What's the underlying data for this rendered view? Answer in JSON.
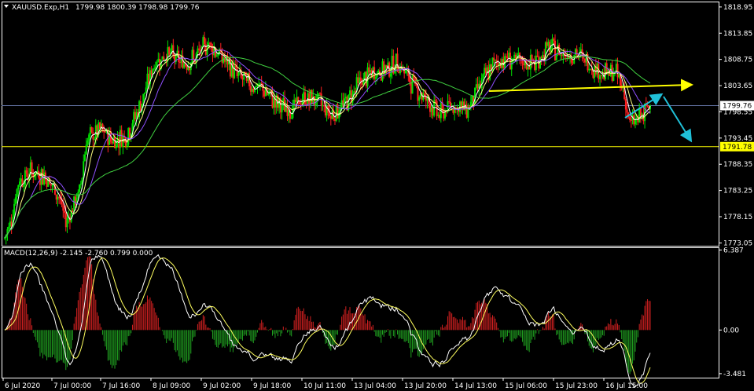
{
  "header": {
    "symbol": "XAUUSD.Exp,H1",
    "ohlc": "1799.98 1800.39 1798.98 1799.76",
    "macd_label": "MACD(12,26,9) -2.145 -2.760 0.799 0.000"
  },
  "colors": {
    "background": "#000000",
    "frame": "#ffffff",
    "bull": "#00e000",
    "bear": "#ff2020",
    "ma_fast": "#ffffff",
    "ma_mid": "#ffff80",
    "ma_slow": "#9050ff",
    "ma_long": "#40d040",
    "level": "#ffff00",
    "bid_line": "#6070a0",
    "arrow_yellow": "#ffff00",
    "arrow_cyan": "#20c0d8",
    "macd_pos": "#d02020",
    "macd_neg": "#20a020",
    "macd_line": "#ffffff",
    "signal_line": "#ffff60"
  },
  "chart_data": [
    {
      "type": "candlestick",
      "title": "XAUUSD.Exp,H1",
      "y_ticks": [
        "1818.95",
        "1813.85",
        "1808.75",
        "1803.65",
        "1798.55",
        "1793.45",
        "1788.35",
        "1783.25",
        "1778.15",
        "1773.05"
      ],
      "ylim": [
        1772.5,
        1820.0
      ],
      "x_ticks": [
        "6 Jul 2020",
        "7 Jul 00:00",
        "7 Jul 16:00",
        "8 Jul 09:00",
        "9 Jul 02:00",
        "9 Jul 18:00",
        "10 Jul 11:00",
        "13 Jul 04:00",
        "13 Jul 20:00",
        "14 Jul 13:00",
        "15 Jul 06:00",
        "15 Jul 23:00",
        "16 Jul 15:00"
      ],
      "current_price": "1799.76",
      "horizontal_level": "1791.78",
      "close_anchors": [
        [
          0,
          1774
        ],
        [
          5,
          1778
        ],
        [
          10,
          1785
        ],
        [
          20,
          1787
        ],
        [
          30,
          1786
        ],
        [
          40,
          1782
        ],
        [
          45,
          1777
        ],
        [
          55,
          1783
        ],
        [
          60,
          1793
        ],
        [
          70,
          1795
        ],
        [
          80,
          1793
        ],
        [
          90,
          1794
        ],
        [
          100,
          1800
        ],
        [
          110,
          1808
        ],
        [
          120,
          1810
        ],
        [
          130,
          1808
        ],
        [
          140,
          1809
        ],
        [
          150,
          1812
        ],
        [
          160,
          1809
        ],
        [
          170,
          1806
        ],
        [
          180,
          1804
        ],
        [
          190,
          1803
        ],
        [
          200,
          1800
        ],
        [
          210,
          1799
        ],
        [
          220,
          1801
        ],
        [
          230,
          1801
        ],
        [
          240,
          1798
        ],
        [
          250,
          1800
        ],
        [
          260,
          1804
        ],
        [
          270,
          1806
        ],
        [
          280,
          1807
        ],
        [
          290,
          1808
        ],
        [
          300,
          1804
        ],
        [
          310,
          1801
        ],
        [
          320,
          1798
        ],
        [
          330,
          1800
        ],
        [
          340,
          1799
        ],
        [
          350,
          1804
        ],
        [
          360,
          1808
        ],
        [
          370,
          1809
        ],
        [
          380,
          1808
        ],
        [
          390,
          1808
        ],
        [
          400,
          1811
        ],
        [
          410,
          1810
        ],
        [
          420,
          1810
        ],
        [
          430,
          1808
        ],
        [
          440,
          1806
        ],
        [
          450,
          1806
        ],
        [
          455,
          1803
        ],
        [
          460,
          1796
        ],
        [
          465,
          1797
        ],
        [
          470,
          1798
        ],
        [
          475,
          1799.76
        ]
      ]
    },
    {
      "type": "macd",
      "title": "MACD(12,26,9)",
      "params": [
        12,
        26,
        9
      ],
      "values": {
        "main": "-2.145",
        "signal": "-2.760",
        "histogram": "0.799",
        "zero": "0.000"
      },
      "y_ticks": [
        "6.387",
        "0.00",
        "-3.481"
      ],
      "ylim": [
        -3.8,
        6.6
      ]
    }
  ]
}
